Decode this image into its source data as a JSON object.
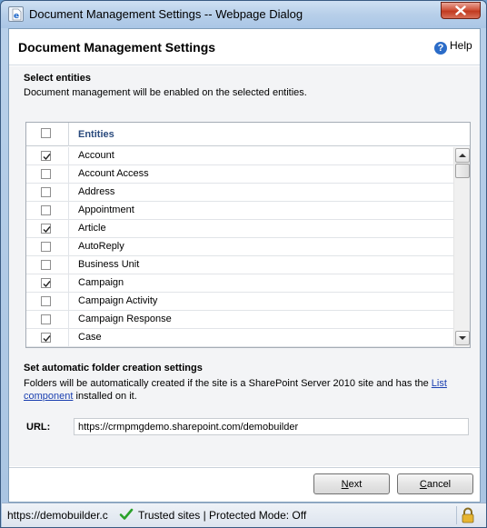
{
  "window": {
    "title": "Document Management Settings -- Webpage Dialog",
    "close_icon": "close-icon",
    "app_icon": "ie-page-icon"
  },
  "header": {
    "title": "Document Management Settings",
    "help_label": "Help",
    "help_icon": "help-icon"
  },
  "entities_section": {
    "title": "Select entities",
    "description": "Document management will be enabled on the selected entities."
  },
  "grid": {
    "column_header": "Entities",
    "select_all_checked": false,
    "rows": [
      {
        "label": "Account",
        "checked": true
      },
      {
        "label": "Account Access",
        "checked": false
      },
      {
        "label": "Address",
        "checked": false
      },
      {
        "label": "Appointment",
        "checked": false
      },
      {
        "label": "Article",
        "checked": true
      },
      {
        "label": "AutoReply",
        "checked": false
      },
      {
        "label": "Business Unit",
        "checked": false
      },
      {
        "label": "Campaign",
        "checked": true
      },
      {
        "label": "Campaign Activity",
        "checked": false
      },
      {
        "label": "Campaign Response",
        "checked": false
      },
      {
        "label": "Case",
        "checked": true
      }
    ]
  },
  "folder_section": {
    "title": "Set automatic folder creation settings",
    "desc_line1": "Folders will be automatically created if the site is a SharePoint Server 2010 site and has the ",
    "desc_link1": "List",
    "desc_link2": "component",
    "desc_line2": " installed on it."
  },
  "url": {
    "label": "URL:",
    "value": "https://crmpmgdemo.sharepoint.com/demobuilder"
  },
  "buttons": {
    "next_mnemonic": "N",
    "next_rest": "ext",
    "cancel_mnemonic": "C",
    "cancel_rest": "ancel"
  },
  "statusbar": {
    "url_text": "https://demobuilder.c",
    "zone_text": "Trusted sites | Protected Mode: Off",
    "check_icon": "green-check-icon",
    "lock_icon": "padlock-icon"
  }
}
